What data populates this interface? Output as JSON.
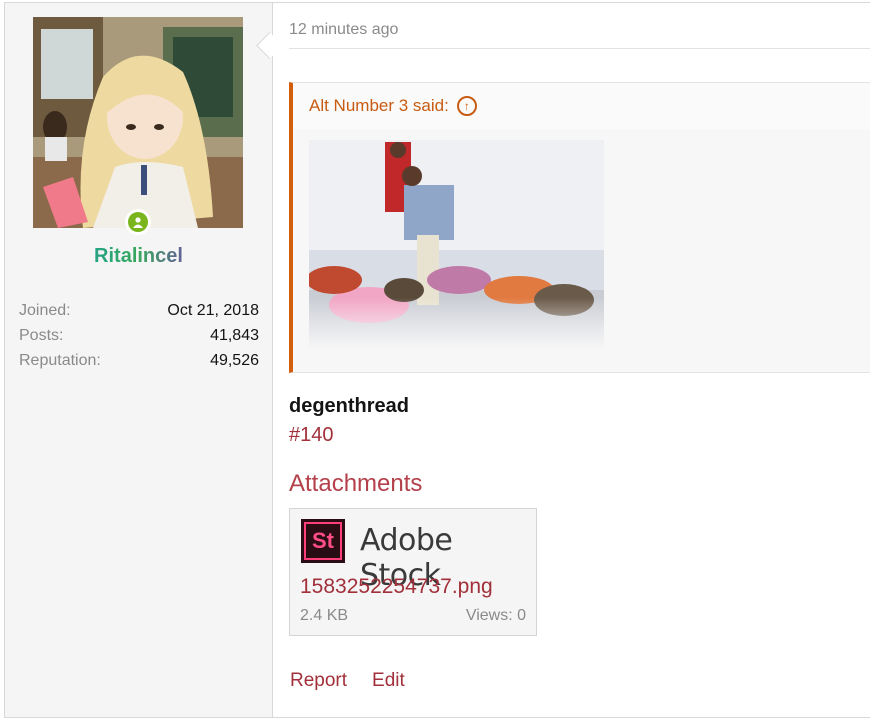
{
  "user": {
    "name": "Ritalincel",
    "stats": [
      {
        "label": "Joined:",
        "value": "Oct 21, 2018"
      },
      {
        "label": "Posts:",
        "value": "41,843"
      },
      {
        "label": "Reputation:",
        "value": "49,526"
      }
    ]
  },
  "post": {
    "timestamp": "12 minutes ago",
    "quote_author": "Alt Number 3 said:",
    "thread_title": "degenthread",
    "post_number": "#140"
  },
  "attachments": {
    "heading": "Attachments",
    "items": [
      {
        "brand_logo_text": "St",
        "brand_text": "Adobe Stock",
        "filename": "1583252254737.png",
        "size": "2.4 KB",
        "views": "Views: 0"
      }
    ]
  },
  "actions": {
    "report": "Report",
    "edit": "Edit"
  },
  "colors": {
    "link": "#a2303a",
    "quote_accent": "#d35f0d",
    "online": "#7ab51d"
  }
}
